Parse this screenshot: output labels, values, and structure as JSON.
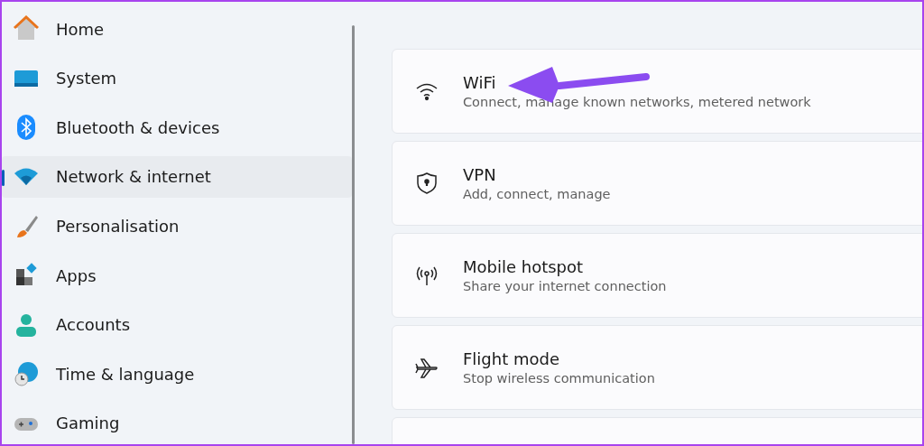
{
  "sidebar": {
    "items": [
      {
        "label": "Home",
        "selected": false
      },
      {
        "label": "System",
        "selected": false
      },
      {
        "label": "Bluetooth & devices",
        "selected": false
      },
      {
        "label": "Network & internet",
        "selected": true
      },
      {
        "label": "Personalisation",
        "selected": false
      },
      {
        "label": "Apps",
        "selected": false
      },
      {
        "label": "Accounts",
        "selected": false
      },
      {
        "label": "Time & language",
        "selected": false
      },
      {
        "label": "Gaming",
        "selected": false
      }
    ]
  },
  "settings": [
    {
      "kind": "link",
      "title": "WiFi",
      "description": "Connect, manage known networks, metered network"
    },
    {
      "kind": "link",
      "title": "VPN",
      "description": "Add, connect, manage"
    },
    {
      "kind": "link",
      "title": "Mobile hotspot",
      "description": "Share your internet connection"
    },
    {
      "kind": "link",
      "title": "Flight mode",
      "description": "Stop wireless communication"
    },
    {
      "kind": "cut_off"
    }
  ]
}
